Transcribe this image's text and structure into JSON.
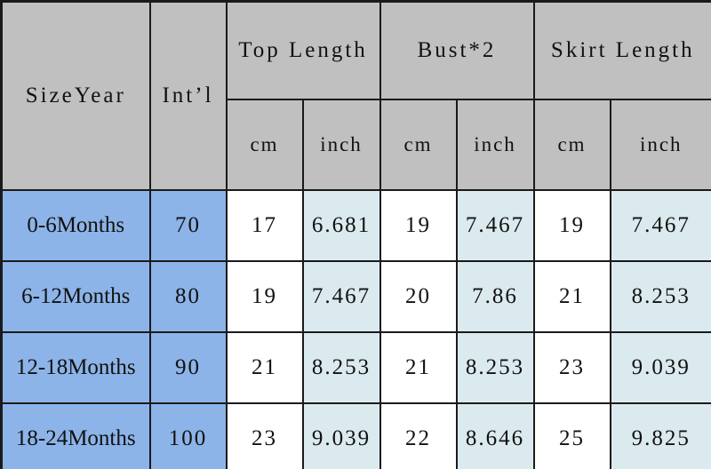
{
  "table": {
    "header": {
      "size_year": "SizeYear",
      "intl": "Int’l",
      "groups": [
        {
          "label": "Top Length",
          "units": [
            "cm",
            "inch"
          ]
        },
        {
          "label": "Bust*2",
          "units": [
            "cm",
            "inch"
          ]
        },
        {
          "label": "Skirt Length",
          "units": [
            "cm",
            "inch"
          ]
        }
      ]
    },
    "rows": [
      {
        "size_year": "0-6Months",
        "intl": "70",
        "top_length_cm": "17",
        "top_length_inch": "6.681",
        "bust_cm": "19",
        "bust_inch": "7.467",
        "skirt_cm": "19",
        "skirt_inch": "7.467"
      },
      {
        "size_year": "6-12Months",
        "intl": "80",
        "top_length_cm": "19",
        "top_length_inch": "7.467",
        "bust_cm": "20",
        "bust_inch": "7.86",
        "skirt_cm": "21",
        "skirt_inch": "8.253"
      },
      {
        "size_year": "12-18Months",
        "intl": "90",
        "top_length_cm": "21",
        "top_length_inch": "8.253",
        "bust_cm": "21",
        "bust_inch": "8.253",
        "skirt_cm": "23",
        "skirt_inch": "9.039"
      },
      {
        "size_year": "18-24Months",
        "intl": "100",
        "top_length_cm": "23",
        "top_length_inch": "9.039",
        "bust_cm": "22",
        "bust_inch": "8.646",
        "skirt_cm": "25",
        "skirt_inch": "9.825"
      }
    ]
  },
  "colors": {
    "header_bg": "#c0c0c0",
    "size_bg": "#8cb4e8",
    "cm_bg": "#ffffff",
    "inch_bg": "#dbeaee",
    "border": "#1a1a1a",
    "text": "#111111"
  }
}
